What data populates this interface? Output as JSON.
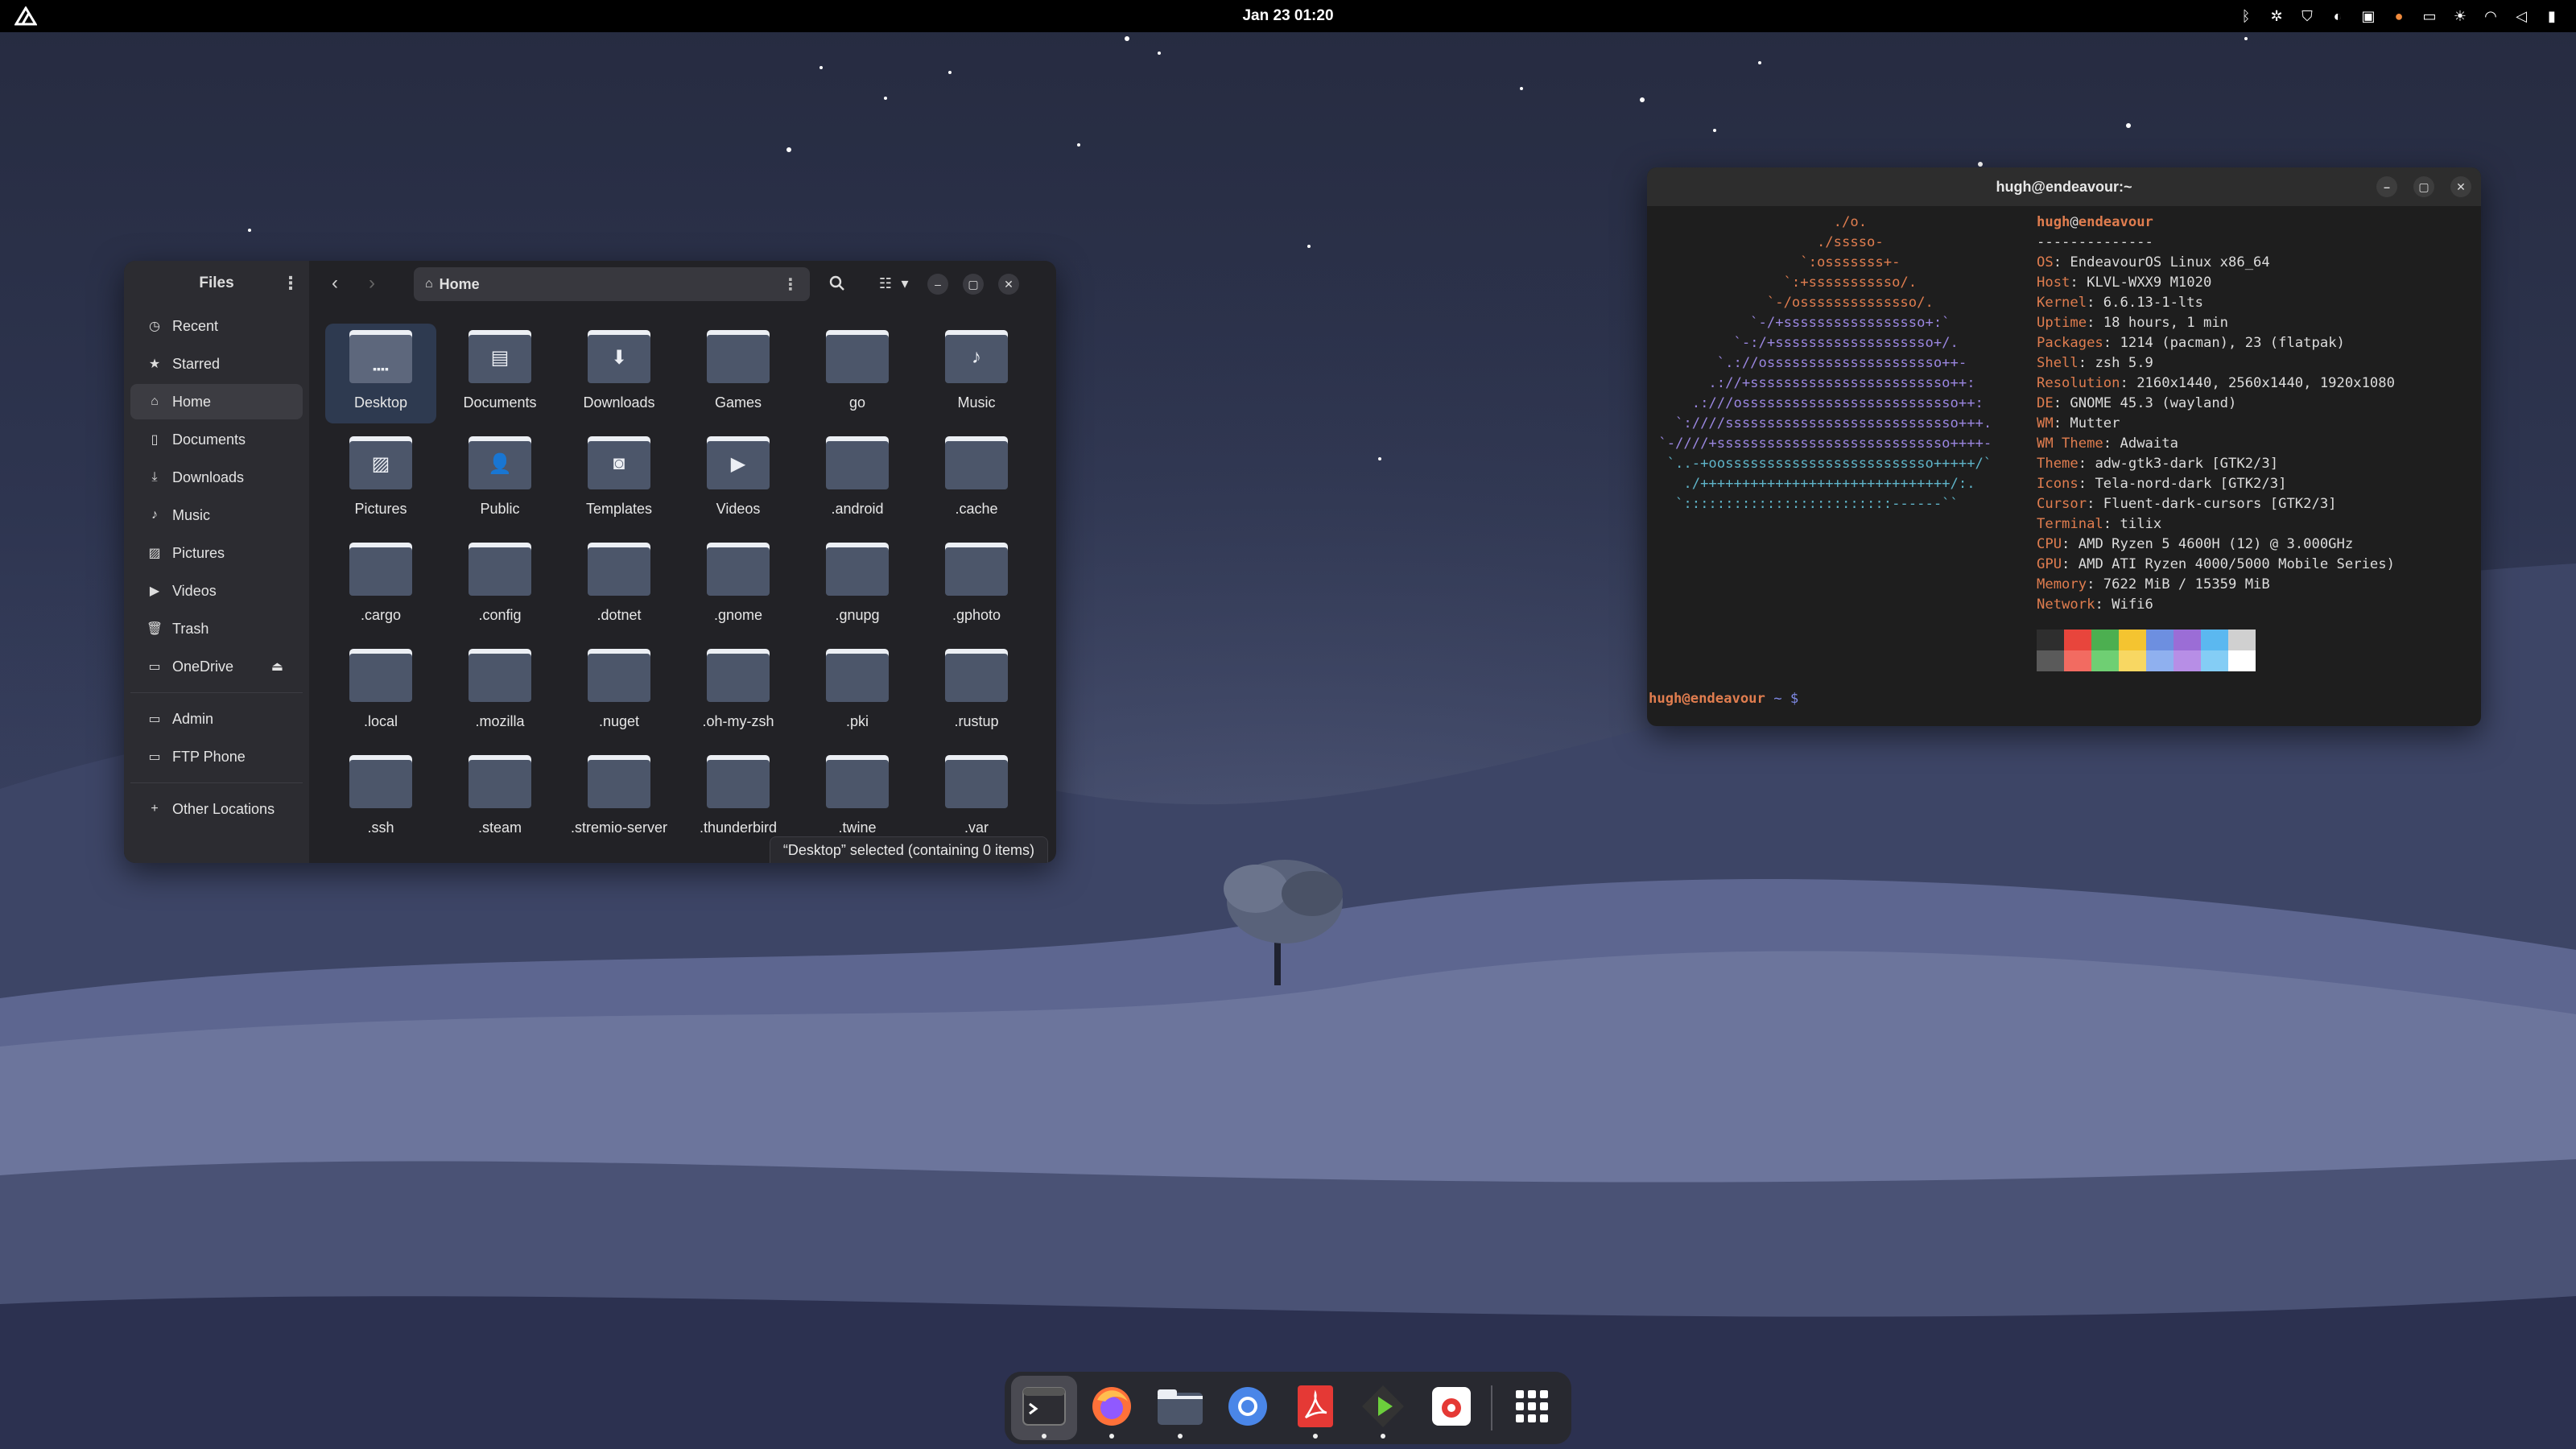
{
  "topbar": {
    "clock": "Jan 23  01:20",
    "logo_icon": "endeavouros-logo-icon",
    "tray_icons": [
      "bluetooth-icon",
      "extension-icon",
      "vpn-shield-icon",
      "sync-icon",
      "clipboard-icon",
      "microphone-icon",
      "screen-icon",
      "brightness-icon",
      "wifi-icon",
      "volume-icon",
      "battery-icon"
    ]
  },
  "files": {
    "sidebar_title": "Files",
    "sidebar_items": [
      {
        "label": "Recent",
        "icon": "clock-icon"
      },
      {
        "label": "Starred",
        "icon": "star-icon"
      },
      {
        "label": "Home",
        "icon": "home-icon",
        "active": true
      },
      {
        "label": "Documents",
        "icon": "document-icon"
      },
      {
        "label": "Downloads",
        "icon": "download-icon"
      },
      {
        "label": "Music",
        "icon": "music-icon"
      },
      {
        "label": "Pictures",
        "icon": "picture-icon"
      },
      {
        "label": "Videos",
        "icon": "video-icon"
      },
      {
        "label": "Trash",
        "icon": "trash-icon"
      },
      {
        "label": "OneDrive",
        "icon": "drive-icon",
        "eject": true
      }
    ],
    "sidebar_bookmarks": [
      {
        "label": "Admin",
        "icon": "folder-icon"
      },
      {
        "label": "FTP Phone",
        "icon": "folder-icon"
      }
    ],
    "other_locations": "Other Locations",
    "path": "Home",
    "items": [
      {
        "name": "Desktop",
        "emblem": "desktop",
        "selected": true
      },
      {
        "name": "Documents",
        "emblem": "document"
      },
      {
        "name": "Downloads",
        "emblem": "download"
      },
      {
        "name": "Games",
        "emblem": ""
      },
      {
        "name": "go",
        "emblem": ""
      },
      {
        "name": "Music",
        "emblem": "music"
      },
      {
        "name": "Pictures",
        "emblem": "picture"
      },
      {
        "name": "Public",
        "emblem": "person"
      },
      {
        "name": "Templates",
        "emblem": "template"
      },
      {
        "name": "Videos",
        "emblem": "video"
      },
      {
        "name": ".android",
        "emblem": ""
      },
      {
        "name": ".cache",
        "emblem": ""
      },
      {
        "name": ".cargo",
        "emblem": ""
      },
      {
        "name": ".config",
        "emblem": ""
      },
      {
        "name": ".dotnet",
        "emblem": ""
      },
      {
        "name": ".gnome",
        "emblem": ""
      },
      {
        "name": ".gnupg",
        "emblem": ""
      },
      {
        "name": ".gphoto",
        "emblem": ""
      },
      {
        "name": ".local",
        "emblem": ""
      },
      {
        "name": ".mozilla",
        "emblem": ""
      },
      {
        "name": ".nuget",
        "emblem": ""
      },
      {
        "name": ".oh-my-zsh",
        "emblem": ""
      },
      {
        "name": ".pki",
        "emblem": ""
      },
      {
        "name": ".rustup",
        "emblem": ""
      },
      {
        "name": ".ssh",
        "emblem": ""
      },
      {
        "name": ".steam",
        "emblem": ""
      },
      {
        "name": ".stremio-server",
        "emblem": ""
      },
      {
        "name": ".thunderbird",
        "emblem": ""
      },
      {
        "name": ".twine",
        "emblem": ""
      },
      {
        "name": ".var",
        "emblem": ""
      }
    ],
    "status": "“Desktop” selected (containing 0 items)"
  },
  "terminal": {
    "title": "hugh@endeavour:~",
    "user": "hugh",
    "host": "endeavour",
    "separator": "--------------",
    "info": [
      {
        "key": "OS",
        "value": "EndeavourOS Linux x86_64"
      },
      {
        "key": "Host",
        "value": "KLVL-WXX9 M1020"
      },
      {
        "key": "Kernel",
        "value": "6.6.13-1-lts"
      },
      {
        "key": "Uptime",
        "value": "18 hours, 1 min"
      },
      {
        "key": "Packages",
        "value": "1214 (pacman), 23 (flatpak)"
      },
      {
        "key": "Shell",
        "value": "zsh 5.9"
      },
      {
        "key": "Resolution",
        "value": "2160x1440, 2560x1440, 1920x1080"
      },
      {
        "key": "DE",
        "value": "GNOME 45.3 (wayland)"
      },
      {
        "key": "WM",
        "value": "Mutter"
      },
      {
        "key": "WM Theme",
        "value": "Adwaita"
      },
      {
        "key": "Theme",
        "value": "adw-gtk3-dark [GTK2/3]"
      },
      {
        "key": "Icons",
        "value": "Tela-nord-dark [GTK2/3]"
      },
      {
        "key": "Cursor",
        "value": "Fluent-dark-cursors [GTK2/3]"
      },
      {
        "key": "Terminal",
        "value": "tilix"
      },
      {
        "key": "CPU",
        "value": "AMD Ryzen 5 4600H (12) @ 3.000GHz"
      },
      {
        "key": "GPU",
        "value": "AMD ATI Ryzen 4000/5000 Mobile Series)"
      },
      {
        "key": "Memory",
        "value": "7622 MiB / 15359 MiB"
      },
      {
        "key": "Network",
        "value": "Wifi6"
      }
    ],
    "palette_top": [
      "#2e2e2e",
      "#e8453c",
      "#4caf50",
      "#f4c430",
      "#6d8fe0",
      "#9b6dd6",
      "#5bb8f0",
      "#d0d0d0"
    ],
    "palette_bottom": [
      "#5a5a5a",
      "#f26b61",
      "#6fcf73",
      "#f8d762",
      "#8fb0ef",
      "#b78ee6",
      "#84cdf5",
      "#ffffff"
    ],
    "prompt_user": "hugh@endeavour",
    "prompt_tail": " ~ $"
  },
  "dock": {
    "apps": [
      {
        "name": "tilix",
        "icon": "terminal-icon",
        "active": true,
        "running": true
      },
      {
        "name": "firefox",
        "icon": "firefox-icon",
        "running": true
      },
      {
        "name": "files",
        "icon": "files-icon",
        "running": true
      },
      {
        "name": "chromium",
        "icon": "chromium-icon",
        "running": false
      },
      {
        "name": "pdf",
        "icon": "pdf-icon",
        "running": true
      },
      {
        "name": "media",
        "icon": "play-icon",
        "running": true
      },
      {
        "name": "store",
        "icon": "store-icon",
        "running": false
      },
      {
        "name": "app-grid",
        "icon": "app-grid-icon",
        "running": false
      }
    ]
  }
}
